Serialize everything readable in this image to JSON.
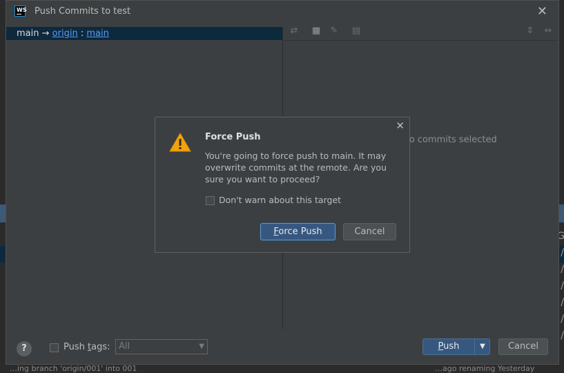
{
  "window": {
    "app_icon_text": "WS",
    "title": "Push Commits to test",
    "close_glyph": "✕"
  },
  "branch_row": {
    "local": "main",
    "arrow": "→",
    "remote": "origin",
    "separator": ":",
    "remote_branch": "main"
  },
  "right_pane": {
    "empty_text": "No commits selected"
  },
  "footer": {
    "help_label": "?",
    "push_tags_prefix": "Push ",
    "push_tags_mnemonic": "t",
    "push_tags_suffix": "ags:",
    "tags_select_value": "All",
    "push_mnemonic": "P",
    "push_rest": "ush",
    "cancel_label": "Cancel"
  },
  "force_push_dialog": {
    "title": "Force Push",
    "message": "You're going to force push to main. It may overwrite commits at the remote. Are you sure you want to proceed?",
    "dont_warn_label": "Don't warn about this target",
    "force_push_mnemonic": "F",
    "force_push_rest": "orce Push",
    "cancel_label": "Cancel",
    "close_glyph": "✕"
  },
  "background": {
    "bottom_text": "…ing branch 'origin/001' into 001",
    "bottom_right_text": "…ago renaming      Yesterday",
    "right_glyphs": [
      "G",
      "/",
      "/",
      "/",
      "/",
      "/",
      "/",
      "/"
    ]
  },
  "colors": {
    "dialog_bg": "#3c3f41",
    "selection_bg": "#0d293e",
    "link": "#589df6",
    "primary_button": "#365880",
    "warning": "#f0a30a"
  }
}
